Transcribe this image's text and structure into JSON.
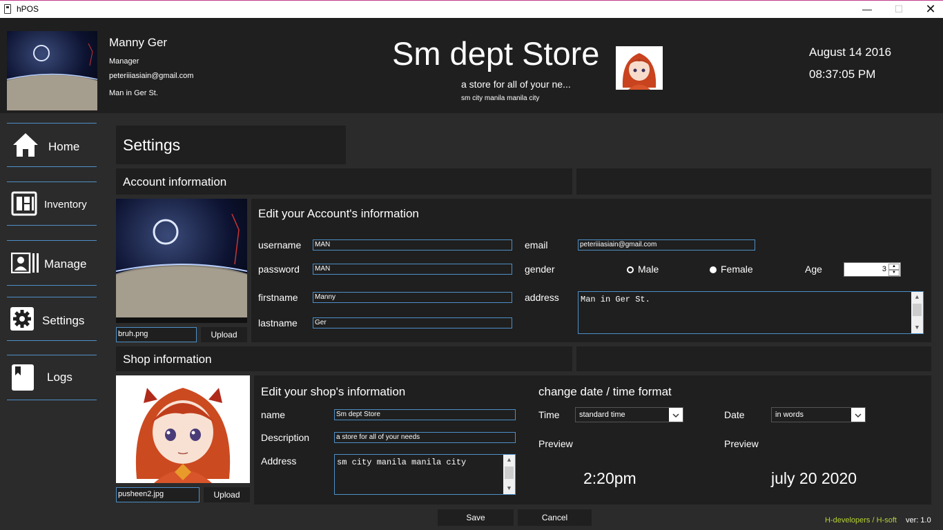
{
  "window": {
    "title": "hPOS",
    "min_glyph": "—",
    "max_glyph": "☐",
    "close_glyph": "✕"
  },
  "user": {
    "name": "Manny Ger",
    "role": "Manager",
    "email": "peteriiiasiain@gmail.com",
    "address": "Man in Ger  St."
  },
  "store": {
    "name": "Sm dept Store",
    "tagline": "a store for all of your ne...",
    "address": "sm city manila manila city"
  },
  "clock": {
    "date": "August 14 2016",
    "time": "08:37:05 PM"
  },
  "sidebar": {
    "items": [
      {
        "label": "Home",
        "icon": "home-icon"
      },
      {
        "label": "Inventory",
        "icon": "inventory-icon"
      },
      {
        "label": "Manage",
        "icon": "manage-icon"
      },
      {
        "label": "Settings",
        "icon": "gear-icon"
      },
      {
        "label": "Logs",
        "icon": "book-icon"
      }
    ]
  },
  "settings": {
    "title": "Settings",
    "account": {
      "header": "Account information",
      "edit_title": "Edit your Account's information",
      "username_label": "username",
      "username": "MAN",
      "password_label": "password",
      "password": "MAN",
      "firstname_label": "firstname",
      "firstname": "Manny",
      "lastname_label": "lastname",
      "lastname": "Ger",
      "email_label": "email",
      "email": "peteriiiasiain@gmail.com",
      "gender_label": "gender",
      "gender_male": "Male",
      "gender_female": "Female",
      "age_label": "Age",
      "age": "3",
      "address_label": "address",
      "address": "Man in Ger  St.",
      "photo_file": "bruh.png",
      "upload_label": "Upload"
    },
    "shop": {
      "header": "Shop information",
      "edit_title": "Edit your shop's information",
      "name_label": "name",
      "name": "Sm dept Store",
      "description_label": "Description",
      "description": "a store for all of your needs",
      "address_label": "Address",
      "address": "sm city manila manila city",
      "photo_file": "pusheen2.jpg",
      "upload_label": "Upload"
    },
    "format": {
      "title": "change date / time format",
      "time_label": "Time",
      "time_option": "standard time",
      "date_label": "Date",
      "date_option": "in words",
      "preview_label": "Preview",
      "time_preview": "2:20pm",
      "date_preview": "july 20 2020"
    },
    "save_label": "Save",
    "cancel_label": "Cancel"
  },
  "footer": {
    "credits": "H-developers / H-soft",
    "version": "ver: 1.0"
  },
  "colors": {
    "accent": "#4e90c9",
    "panel": "#1f1f1f",
    "background": "#2b2b2b",
    "credits": "#b5d334"
  }
}
